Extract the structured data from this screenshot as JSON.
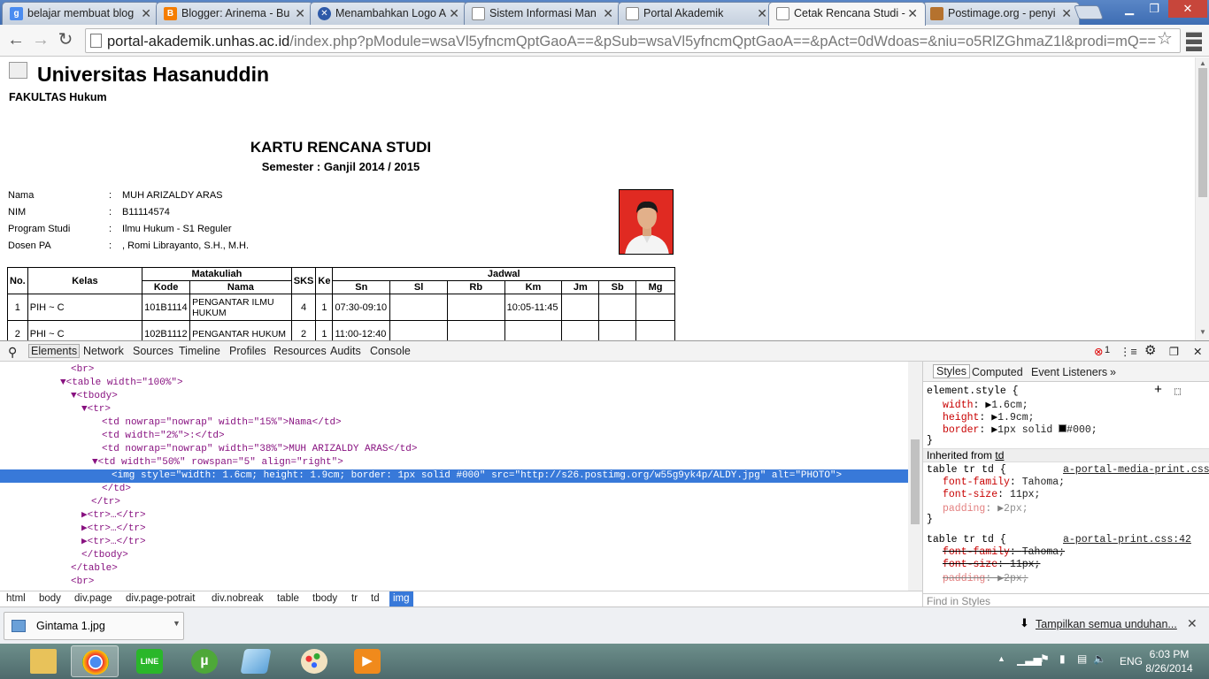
{
  "browser": {
    "tabs": [
      {
        "label": "belajar membuat blog",
        "fav_color": "#4a8cf0",
        "fav_char": "g"
      },
      {
        "label": "Blogger: Arinema - Bu",
        "fav_color": "#f57d00",
        "fav_char": "B"
      },
      {
        "label": "Menambahkan Logo A",
        "fav_color": "#2e5aa8",
        "fav_char": "X"
      },
      {
        "label": "Sistem Informasi Man",
        "fav_color": "#ffffff",
        "fav_char": ""
      },
      {
        "label": "Portal Akademik",
        "fav_color": "#ffffff",
        "fav_char": ""
      },
      {
        "label": "Cetak Rencana Studi -",
        "fav_color": "#ffffff",
        "fav_char": ""
      },
      {
        "label": "Postimage.org - penyi",
        "fav_color": "#b5722e",
        "fav_char": ""
      }
    ],
    "active_tab": 5,
    "url_host": "portal-akademik.unhas.ac.id",
    "url_path": "/index.php?pModule=wsaVl5yfncmQptGaoA==&pSub=wsaVl5yfncmQptGaoA==&pAct=0dWdoas=&niu=o5RlZGhmaZ1l&prodi=mQ=="
  },
  "page": {
    "university": "Universitas Hasanuddin",
    "faculty": "FAKULTAS Hukum",
    "title": "KARTU RENCANA STUDI",
    "semester": "Semester : Ganjil 2014 / 2015",
    "info": [
      {
        "label": "Nama",
        "colon": ":",
        "value": "MUH ARIZALDY ARAS"
      },
      {
        "label": "NIM",
        "colon": ":",
        "value": "B11114574"
      },
      {
        "label": "Program Studi",
        "colon": ":",
        "value": "Ilmu Hukum - S1 Reguler"
      },
      {
        "label": "Dosen PA",
        "colon": ":",
        "value": ", Romi Librayanto, S.H., M.H."
      }
    ],
    "table": {
      "h_no": "No.",
      "h_kelas": "Kelas",
      "h_matakuliah": "Matakuliah",
      "h_sks": "SKS",
      "h_ke": "Ke",
      "h_jadwal": "Jadwal",
      "h_kode": "Kode",
      "h_nama": "Nama",
      "days": [
        "Sn",
        "Sl",
        "Rb",
        "Km",
        "Jm",
        "Sb",
        "Mg"
      ],
      "rows": [
        {
          "no": "1",
          "kelas": "PIH ~ C",
          "kode": "101B1114",
          "nama": "PENGANTAR ILMU HUKUM",
          "sks": "4",
          "ke": "1",
          "sn": "07:30-09:10",
          "sl": "",
          "rb": "",
          "km": "10:05-11:45",
          "jm": "",
          "sb": "",
          "mg": ""
        },
        {
          "no": "2",
          "kelas": "PHI ~ C",
          "kode": "102B1112",
          "nama": "PENGANTAR HUKUM",
          "sks": "2",
          "ke": "1",
          "sn": "11:00-12:40",
          "sl": "",
          "rb": "",
          "km": "",
          "jm": "",
          "sb": "",
          "mg": ""
        }
      ]
    }
  },
  "devtools": {
    "tabs": [
      "Elements",
      "Network",
      "Sources",
      "Timeline",
      "Profiles",
      "Resources",
      "Audits",
      "Console"
    ],
    "error_count": "1",
    "breadcrumbs": [
      "html",
      "body",
      "div.page",
      "div.page-potrait",
      "div.nobreak",
      "table",
      "tbody",
      "tr",
      "td",
      "img"
    ],
    "styles_tabs": [
      "Styles",
      "Computed",
      "Event Listeners"
    ],
    "element_style_selector": "element.style {",
    "element_style": [
      {
        "prop": "width",
        "value": "1.6cm;"
      },
      {
        "prop": "height",
        "value": "1.9cm;"
      },
      {
        "prop": "border",
        "value": "1px solid ",
        "value2": "#000;"
      }
    ],
    "inherited_label": "Inherited from",
    "inherited_from": "td",
    "rule1": {
      "selector": "table tr td {",
      "source": "a-portal-media-print.css:50",
      "props": [
        {
          "prop": "font-family",
          "value": "Tahoma;"
        },
        {
          "prop": "font-size",
          "value": "11px;"
        },
        {
          "prop": "padding",
          "value": "2px;"
        }
      ]
    },
    "rule2": {
      "selector": "table tr td {",
      "source": "a-portal-print.css:42",
      "props": [
        {
          "prop": "font-family",
          "value": "Tahoma;"
        },
        {
          "prop": "font-size",
          "value": "11px;"
        },
        {
          "prop": "padding",
          "value": "2px;"
        }
      ]
    },
    "find_placeholder": "Find in Styles",
    "dom": {
      "br1": "<br>",
      "table_open": "<table width=\"100%\">",
      "tbody_open": "<tbody>",
      "tr_open": "<tr>",
      "td1": "<td nowrap=\"nowrap\" width=\"15%\">Nama</td>",
      "td2": "<td width=\"2%\">:</td>",
      "td3": "<td nowrap=\"nowrap\" width=\"38%\">MUH ARIZALDY ARAS</td>",
      "td4": "<td width=\"50%\" rowspan=\"5\" align=\"right\">",
      "img": "<img style=\"width: 1.6cm; height: 1.9cm; border: 1px solid #000\" src=\"http://s26.postimg.org/w55g9yk4p/ALDY.jpg\" alt=\"PHOTO\">",
      "td_close": "</td>",
      "tr_close": "</tr>",
      "tr_collapsed": "<tr>…</tr>",
      "tbody_close": "</tbody>",
      "table_close": "</table>",
      "br2": "<br>"
    }
  },
  "download": {
    "file": "Gintama 1.jpg",
    "show_all": "Tampilkan semua unduhan..."
  },
  "taskbar": {
    "lang": "ENG",
    "time": "6:03 PM",
    "date": "8/26/2014"
  }
}
